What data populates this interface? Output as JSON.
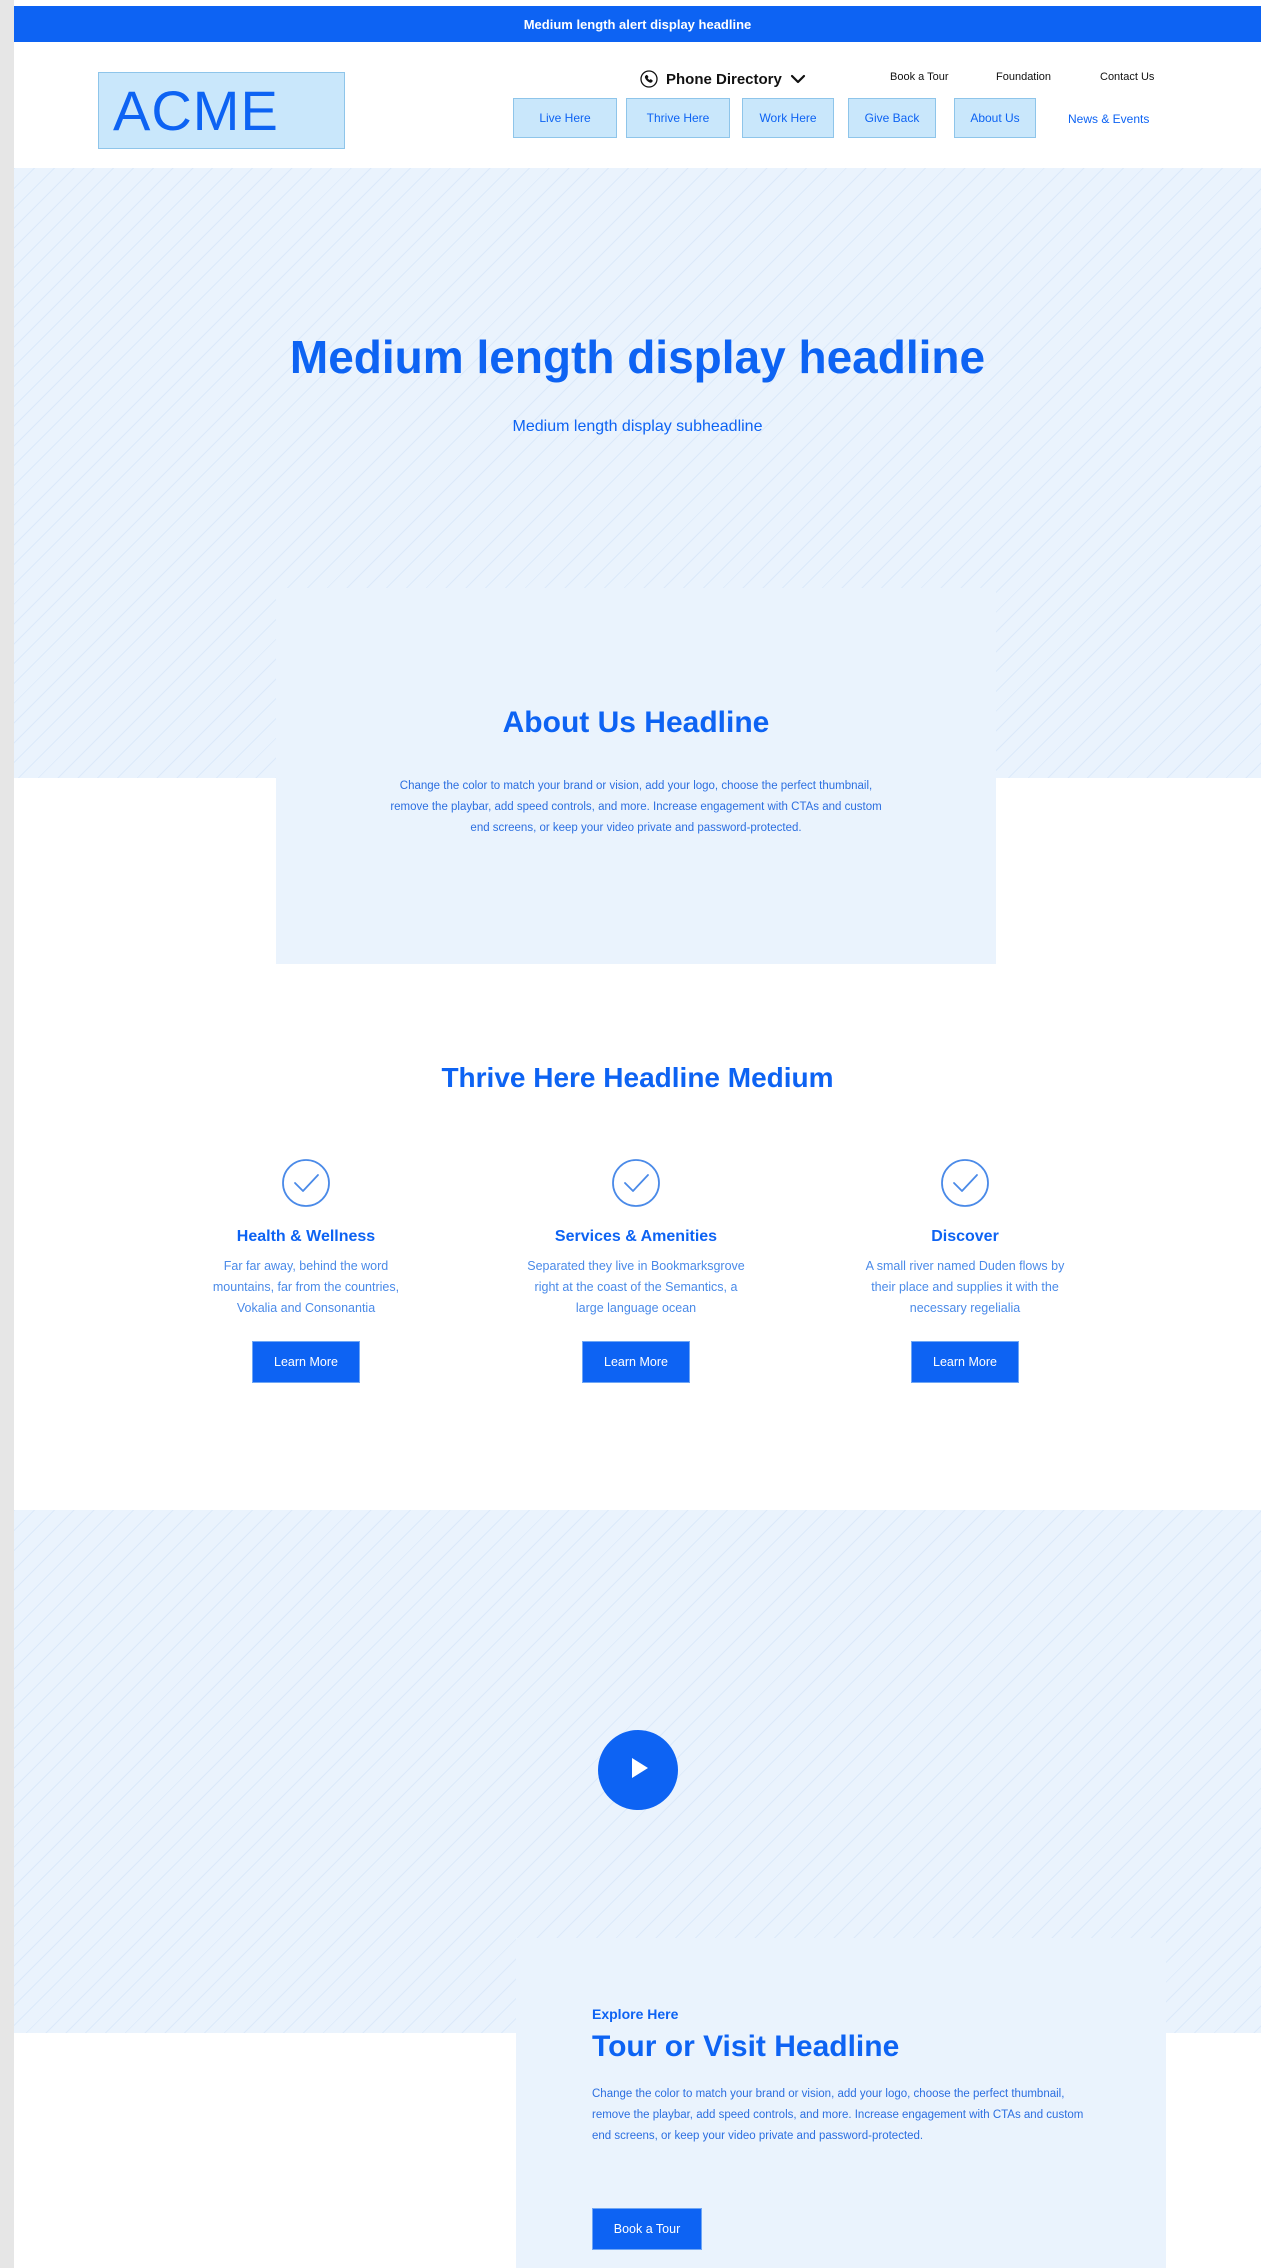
{
  "alert": {
    "headline": "Medium length alert display headline"
  },
  "header": {
    "logo_text": "ACME",
    "phone_directory": {
      "label": "Phone Directory",
      "icon": "phone-icon",
      "chevron": "chevron-down-icon"
    },
    "utility_links": [
      "Book a Tour",
      "Foundation",
      "Contact Us"
    ],
    "nav": [
      "Live Here",
      "Thrive Here",
      "Work Here",
      "Give Back",
      "About Us",
      "News & Events"
    ]
  },
  "hero": {
    "headline": "Medium length display headline",
    "subheadline": "Medium length display subheadline"
  },
  "about": {
    "headline": "About Us Headline",
    "body": "Change the color to match your brand or vision, add your logo, choose the perfect thumbnail, remove the playbar, add speed controls, and more. Increase engagement with CTAs and custom end screens, or keep your video private and password-protected."
  },
  "thrive": {
    "headline": "Thrive Here Headline Medium",
    "features": [
      {
        "title": "Health & Wellness",
        "text": "Far far away, behind the word mountains, far from the countries, Vokalia and Consonantia",
        "button": "Learn More",
        "icon": "check-circle-icon"
      },
      {
        "title": "Services & Amenities",
        "text": "Separated they live in Bookmarksgrove right at the coast of the Semantics, a large language ocean",
        "button": "Learn More",
        "icon": "check-circle-icon"
      },
      {
        "title": "Discover",
        "text": "A small river named Duden flows by their place and supplies it with the necessary regelialia",
        "button": "Learn More",
        "icon": "check-circle-icon"
      }
    ]
  },
  "video": {
    "icon": "play-icon"
  },
  "tour": {
    "eyebrow": "Explore Here",
    "headline": "Tour or Visit Headline",
    "body": "Change the color to match your brand or vision, add your logo, choose the perfect thumbnail, remove the playbar, add speed controls, and more. Increase engagement with CTAs and custom end screens, or keep your video private and password-protected.",
    "button": "Book a Tour"
  },
  "colors": {
    "primary": "#0d63f3",
    "light_panel": "#eaf3fd",
    "nav_fill": "#c9e7fb"
  }
}
